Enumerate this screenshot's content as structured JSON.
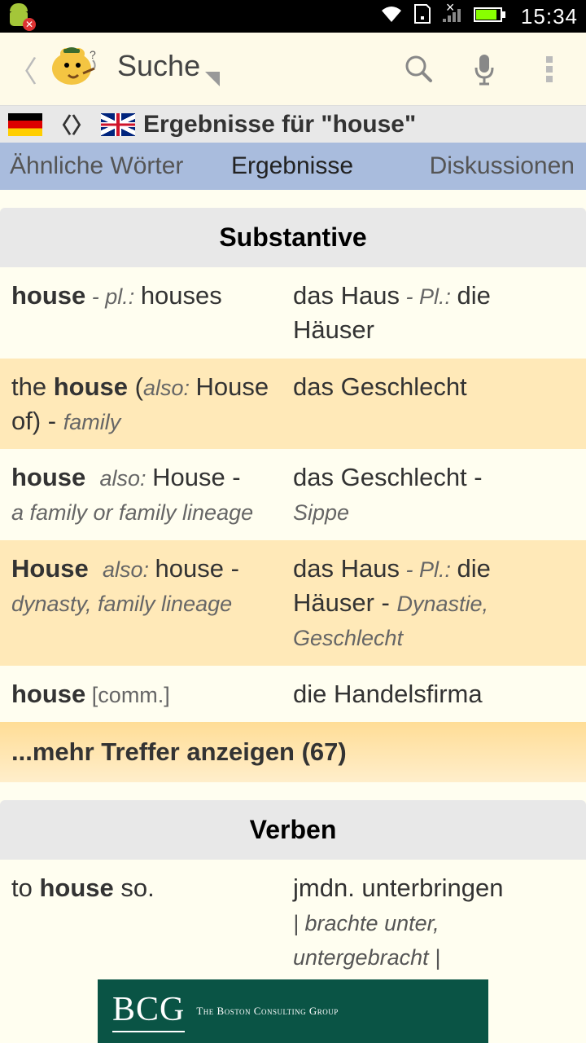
{
  "status": {
    "time": "15:34"
  },
  "appbar": {
    "search_label": "Suche"
  },
  "results_header": {
    "text": "Ergebnisse für \"house\""
  },
  "tabs": {
    "similar": "Ähnliche Wörter",
    "results": "Ergebnisse",
    "discussions": "Diskussionen"
  },
  "sections": {
    "nouns": "Substantive",
    "verbs": "Verben"
  },
  "rows": {
    "r1": {
      "en_term": "house",
      "en_meta": " - pl.: ",
      "en_plural": "houses",
      "de_term": "das Haus",
      "de_meta": " - Pl.: ",
      "de_plural": "die Häuser"
    },
    "r2": {
      "en_pre": "the ",
      "en_term": "house",
      "en_paren_open": " (",
      "en_also": "also: ",
      "en_alt": "House of",
      "en_paren_close": ")   - ",
      "en_note": "family",
      "de_term": "das Geschlecht"
    },
    "r3": {
      "en_term": "house",
      "en_also": "also: ",
      "en_alt": "House",
      "en_dash": "   -",
      "en_note": "a family or family lineage",
      "de_term": "das Geschlecht",
      "de_dash": "   -",
      "de_note": "Sippe"
    },
    "r4": {
      "en_term": "House",
      "en_also": "also: ",
      "en_alt": "house",
      "en_dash": "   -",
      "en_note": "dynasty, family lineage",
      "de_term": "das Haus",
      "de_meta": " - Pl.: ",
      "de_plural": "die Häuser",
      "de_dash": "   - ",
      "de_note": "Dynastie, Geschlecht"
    },
    "r5": {
      "en_term": "house",
      "en_tag": " [comm.]",
      "de_term": "die Handelsfirma"
    },
    "more": "...mehr Treffer anzeigen (67)",
    "v1": {
      "en_pre": "to ",
      "en_term": "house",
      "en_post": " so.",
      "de_term": "jmdn. unterbringen",
      "de_forms": "| brachte unter, untergebracht |"
    }
  },
  "ad": {
    "logo": "BCG",
    "tag": "The Boston Consulting Group"
  },
  "chart_data": {
    "type": "table",
    "note": "not a chart"
  }
}
